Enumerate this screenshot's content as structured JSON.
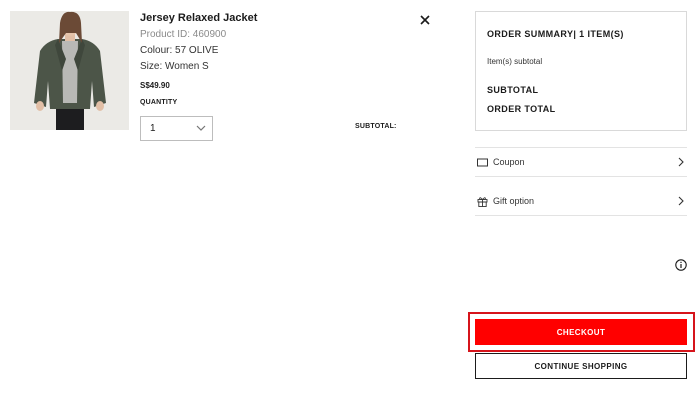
{
  "product": {
    "name": "Jersey Relaxed Jacket",
    "product_id": "Product ID: 460900",
    "colour": "Colour: 57 OLIVE",
    "size": "Size: Women S",
    "price": "S$49.90",
    "quantity_label": "QUANTITY",
    "quantity_value": "1",
    "subtotal_label": "SUBTOTAL:",
    "image_icon": "model-wearing-olive-jacket"
  },
  "summary": {
    "title": "ORDER SUMMARY| 1 ITEM(S)",
    "items_subtotal": "Item(s) subtotal",
    "subtotal": "SUBTOTAL",
    "order_total": "ORDER TOTAL"
  },
  "options": [
    {
      "label": "Coupon",
      "icon": "coupon-icon"
    },
    {
      "label": "Gift option",
      "icon": "gift-icon"
    }
  ],
  "buttons": {
    "checkout": "CHECKOUT",
    "continue_shopping": "CONTINUE SHOPPING"
  },
  "colors": {
    "checkout_bg": "#ff0000",
    "highlight_border": "#d6141b"
  }
}
